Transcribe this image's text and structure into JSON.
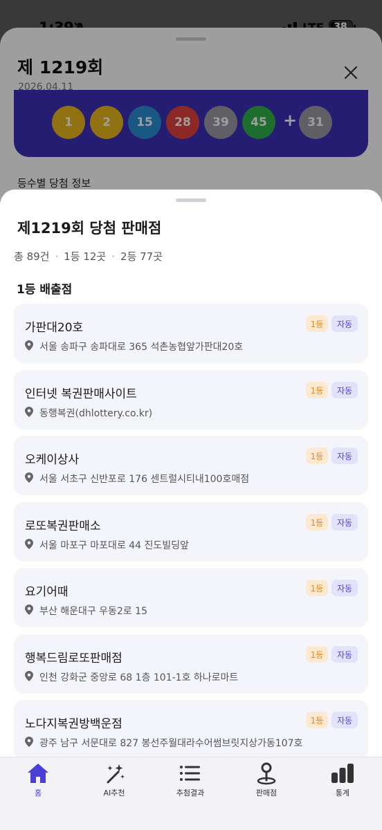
{
  "status_bar": {
    "time": "1:39",
    "network": "LTE",
    "battery": "38"
  },
  "draw_header": {
    "title": "제 1219회",
    "date": "2026.04.11",
    "numbers": [
      {
        "value": "1",
        "color": "#e8b820"
      },
      {
        "value": "2",
        "color": "#e8b820"
      },
      {
        "value": "15",
        "color": "#2b8fd6"
      },
      {
        "value": "28",
        "color": "#e2423c"
      },
      {
        "value": "39",
        "color": "#9a9aa4"
      },
      {
        "value": "45",
        "color": "#2fb14d"
      }
    ],
    "plus": "+",
    "bonus": {
      "value": "31",
      "color": "#9a9aa4"
    },
    "section_caption": "등수별 당첨 정보"
  },
  "sheet": {
    "title": "제1219회 당첨 판매점",
    "summary": {
      "total": "총 89건",
      "first": "1등 12곳",
      "second": "2등 77곳",
      "separator": "·"
    },
    "first_heading": "1등 배출점",
    "stores": [
      {
        "name": "가판대20호",
        "rank": "1등",
        "type": "자동",
        "address": "서울 송파구 송파대로 365 석촌농협앞가판대20호"
      },
      {
        "name": "인터넷 복권판매사이트",
        "rank": "1등",
        "type": "자동",
        "address": "동행복권(dhlottery.co.kr)"
      },
      {
        "name": "오케이상사",
        "rank": "1등",
        "type": "자동",
        "address": "서울 서초구 신반포로 176 센트럴시티내100호매점"
      },
      {
        "name": "로또복권판매소",
        "rank": "1등",
        "type": "자동",
        "address": "서울 마포구 마포대로 44 진도빌딩앞"
      },
      {
        "name": "요기어때",
        "rank": "1등",
        "type": "자동",
        "address": "부산 해운대구 우동2로 15"
      },
      {
        "name": "행복드림로또판매점",
        "rank": "1등",
        "type": "자동",
        "address": "인천 강화군 중앙로 68 1층 101-1호 하나로마트"
      },
      {
        "name": "노다지복권방백운점",
        "rank": "1등",
        "type": "자동",
        "address": "광주 남구 서문대로 827 봉선주월대라수어썸브릿지상가동107호"
      }
    ]
  },
  "tabbar": {
    "tabs": [
      {
        "label": "홈",
        "icon": "home-icon",
        "active": true
      },
      {
        "label": "AI추천",
        "icon": "magic-wand-icon",
        "active": false
      },
      {
        "label": "추첨결과",
        "icon": "list-icon",
        "active": false
      },
      {
        "label": "판매점",
        "icon": "map-pin-icon",
        "active": false
      },
      {
        "label": "통계",
        "icon": "bar-chart-icon",
        "active": false
      }
    ]
  },
  "colors": {
    "accent": "#4a3fd8",
    "panel": "#3c2fb8",
    "rank_badge": "#fde9d2",
    "type_badge": "#e3e2fb"
  }
}
